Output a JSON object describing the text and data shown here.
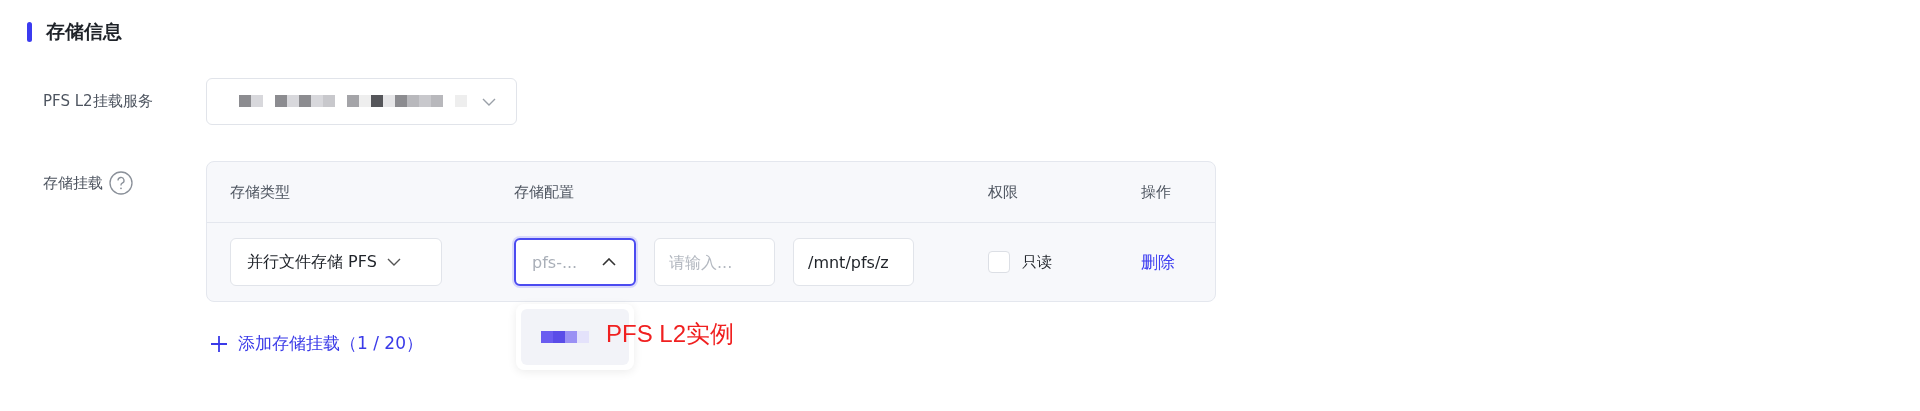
{
  "section_title": "存储信息",
  "mount_service": {
    "label": "PFS L2挂载服务",
    "redacted": true
  },
  "storage_mount": {
    "label": "存储挂载",
    "columns": [
      "存储类型",
      "存储配置",
      "权限",
      "操作"
    ],
    "rows": [
      {
        "type": "并行文件存储 PFS",
        "config_placeholder": "pfs-...",
        "config_expanded": true,
        "input_placeholder": "请输入...",
        "path": "/mnt/pfs/z",
        "readonly_label": "只读",
        "readonly": false,
        "action": "删除"
      }
    ],
    "dropdown_option": {
      "redacted": true,
      "annotation": "PFS L2实例"
    },
    "add_link": "添加存储挂载（1 / 20）"
  }
}
